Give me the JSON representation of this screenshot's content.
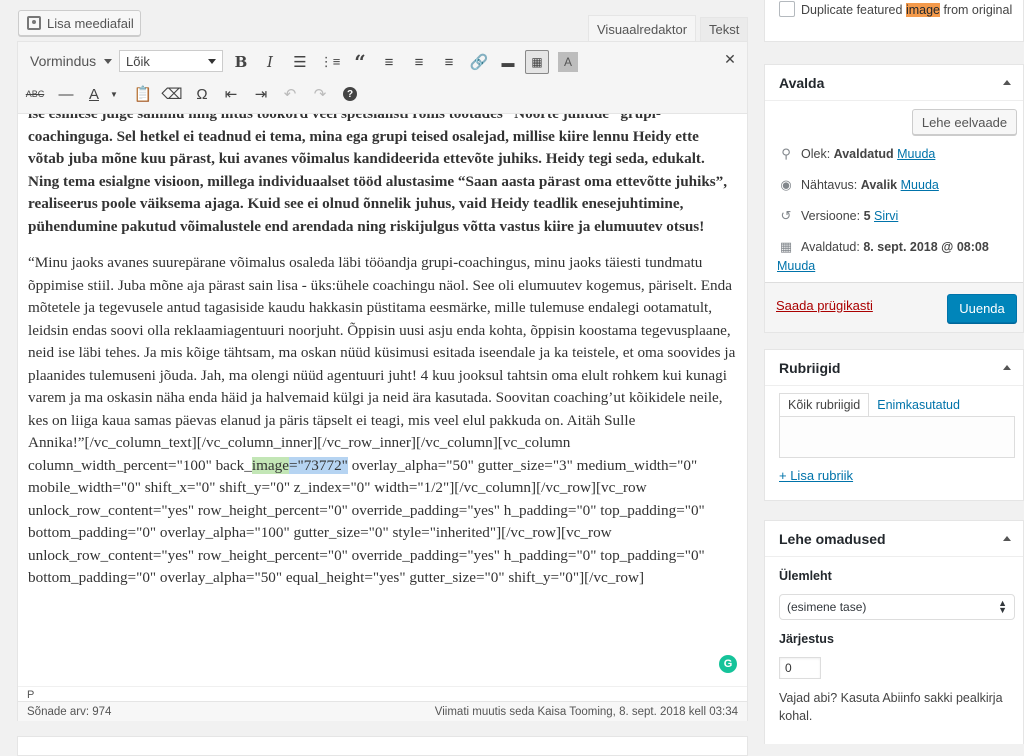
{
  "editor": {
    "add_media_label": "Lisa meediafail",
    "tab_visual": "Visuaalredaktor",
    "tab_text": "Tekst",
    "format_select": "Vormindus",
    "font_select": "Lõik",
    "icons": {
      "bold": "bold-icon",
      "italic": "italic-icon",
      "bullet_list": "bullet-list-icon",
      "numbered_list": "numbered-list-icon",
      "blockquote": "blockquote-icon",
      "align_left": "align-left-icon",
      "align_center": "align-center-icon",
      "align_right": "align-right-icon",
      "link": "link-icon",
      "read_more": "read-more-icon",
      "toolbar_toggle": "toolbar-toggle-icon",
      "wpb": "wpb-icon",
      "fullscreen": "fullscreen-icon",
      "strikethrough": "strikethrough-icon",
      "hr": "horizontal-line-icon",
      "text_color": "text-color-icon",
      "paste_text": "paste-text-icon",
      "clear_format": "clear-formatting-icon",
      "omega": "special-character-icon",
      "outdent": "outdent-icon",
      "indent": "indent-icon",
      "undo": "undo-icon",
      "redo": "redo-icon",
      "help": "help-icon"
    },
    "bold_paragraph": "ise esimese julge sammu ning liitus tookord veel spetsialisti rollis töötades “Noorte juhtide” grupi-coachinguga. Sel hetkel ei teadnud ei tema, mina ega grupi teised osalejad, millise kiire lennu Heidy ette võtab juba mõne kuu pärast, kui avanes võimalus kandideerida ettevõte juhiks. Heidy tegi seda, edukalt. Ning tema esialgne visioon, millega individuaalset tööd alustasime “Saan aasta pärast oma ettevõtte juhiks”, realiseerus poole väiksema ajaga. Kuid see ei olnud õnnelik juhus, vaid Heidy teadlik enesejuhtimine, pühendumine pakutud võimalustele end arendada ning riskijulgus võtta vastus kiire ja elumuutev otsus!",
    "paragraph_before": "“Minu jaoks avanes suurepärane võimalus osaleda läbi tööandja grupi-coachingus, minu jaoks täiesti tundmatu õppimise stiil. Juba mõne aja pärast sain lisa - üks:ühele coachingu näol. See oli elumuutev kogemus, päriselt. Enda mõtetele ja tegevusele antud tagasiside kaudu hakkasin püstitama eesmärke, mille tulemuse endalegi ootamatult, leidsin endas soovi olla reklaamiagentuuri noorjuht. Õppisin uusi asju enda kohta, õppisin koostama tegevusplaane, neid ise läbi tehes. Ja mis kõige tähtsam, ma oskan nüüd küsimusi esitada iseendale ja ka teistele, et oma soovides ja plaanides tulemuseni jõuda. Jah, ma olengi nüüd agentuuri juht!  4 kuu jooksul tahtsin oma elult rohkem kui kunagi varem ja ma oskasin näha enda häid ja halvemaid külgi ja neid ära kasutada. Soovitan coaching’ut kõikidele neile, kes on liiga kaua samas päevas elanud ja päris täpselt ei teagi, mis veel elul pakkuda on. Aitäh Sulle Annika!”[/vc_column_text][/vc_column_inner][/vc_row_inner][/vc_column][vc_column column_width_percent=\"100\" back_",
    "highlight_word": "image",
    "highlight_value": "=\"73772\"",
    "paragraph_after": " overlay_alpha=\"50\" gutter_size=\"3\" medium_width=\"0\" mobile_width=\"0\" shift_x=\"0\" shift_y=\"0\" z_index=\"0\" width=\"1/2\"][/vc_column][/vc_row][vc_row unlock_row_content=\"yes\" row_height_percent=\"0\" override_padding=\"yes\" h_padding=\"0\" top_padding=\"0\" bottom_padding=\"0\" overlay_alpha=\"100\" gutter_size=\"0\" style=\"inherited\"][/vc_row][vc_row unlock_row_content=\"yes\" row_height_percent=\"0\" override_padding=\"yes\" h_padding=\"0\" top_padding=\"0\" bottom_padding=\"0\" overlay_alpha=\"50\" equal_height=\"yes\" gutter_size=\"0\" shift_y=\"0\"][/vc_row]",
    "grammarly_letter": "G",
    "path": "P",
    "word_count": "Sõnade arv: 974",
    "last_modified": "Viimati muutis seda Kaisa Tooming, 8. sept. 2018 kell 03:34"
  },
  "duplicate": {
    "text_before": "Duplicate featured ",
    "highlight": "image",
    "text_after": " from original"
  },
  "publish": {
    "title": "Avalda",
    "preview_label": "Lehe eelvaade",
    "status_label": "Olek:",
    "status_value": "Avaldatud",
    "status_edit": "Muuda",
    "visibility_label": "Nähtavus:",
    "visibility_value": "Avalik",
    "visibility_edit": "Muuda",
    "revisions_label": "Versioone:",
    "revisions_value": "5",
    "revisions_link": "Sirvi",
    "published_label": "Avaldatud:",
    "published_value": "8. sept. 2018 @ 08:08",
    "published_edit": "Muuda",
    "trash_label": "Saada prügikasti",
    "update_label": "Uuenda"
  },
  "categories": {
    "title": "Rubriigid",
    "tab_all": "Kõik rubriigid",
    "tab_popular": "Enimkasutatud",
    "add_label": "+ Lisa rubriik"
  },
  "page_attributes": {
    "title": "Lehe omadused",
    "parent_label": "Ülemleht",
    "parent_value": "(esimene tase)",
    "order_label": "Järjestus",
    "order_value": "0",
    "help_text": "Vajad abi? Kasuta Abiinfo sakki pealkirja kohal."
  }
}
